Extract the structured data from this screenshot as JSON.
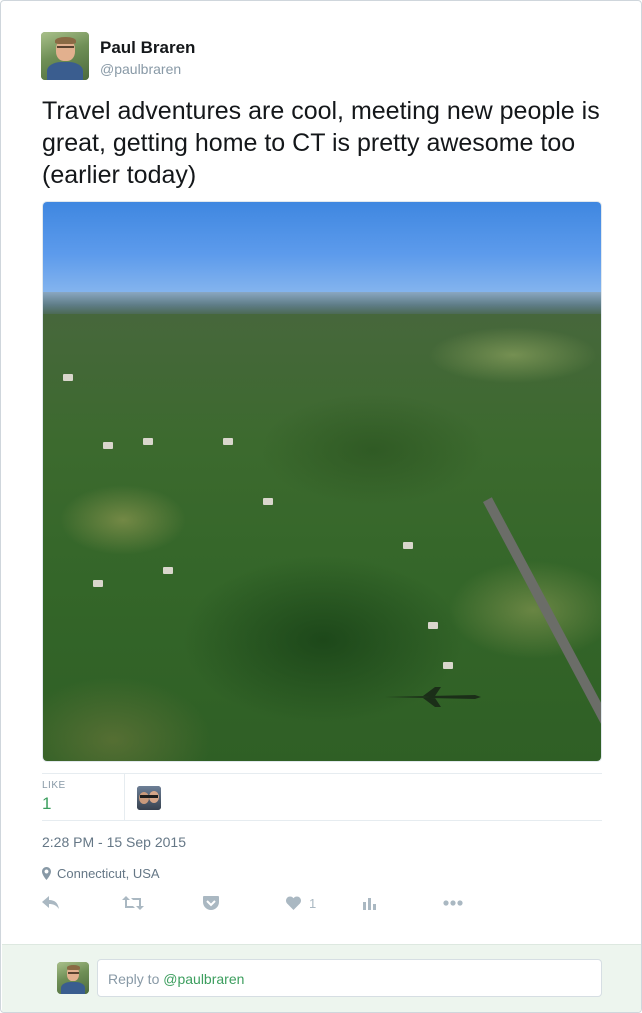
{
  "author": {
    "display_name": "Paul Braren",
    "handle": "@paulbraren"
  },
  "tweet": {
    "text": "Travel adventures are cool, meeting new people is great, getting home to CT is pretty awesome too (earlier today)",
    "photo_description_icon": "aerial-photo"
  },
  "engagement": {
    "like_label": "LIKE",
    "like_count": "1"
  },
  "meta": {
    "timestamp": "2:28 PM - 15 Sep 2015",
    "location": "Connecticut, USA"
  },
  "actions": {
    "reply_icon": "reply-icon",
    "retweet_icon": "retweet-icon",
    "pocket_icon": "pocket-icon",
    "like_icon": "heart-icon",
    "like_count": "1",
    "analytics_icon": "analytics-icon",
    "more_icon": "more-icon"
  },
  "reply": {
    "prefix": "Reply to ",
    "mention": "@paulbraren"
  },
  "colors": {
    "accent_green": "#3c9e5e",
    "muted": "#8899a6",
    "reply_bar_bg": "#edf5ee"
  }
}
